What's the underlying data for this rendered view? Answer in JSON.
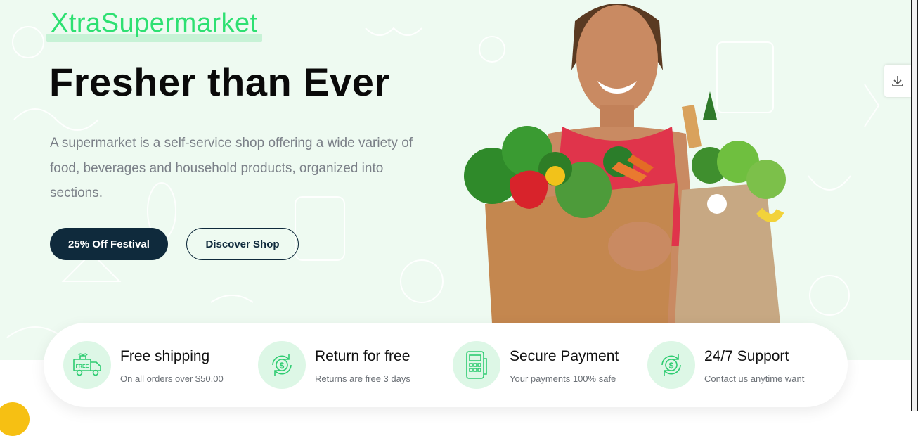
{
  "brand": {
    "name": "XtraSupermarket"
  },
  "hero": {
    "headline": "Fresher than Ever",
    "description": "A supermarket is a self-service shop offering a wide variety of food, beverages and household products, organized into sections.",
    "primary_button": "25% Off Festival",
    "secondary_button": "Discover Shop"
  },
  "features": [
    {
      "title": "Free shipping",
      "subtitle": "On all orders over $50.00",
      "icon": "free-delivery-truck-icon"
    },
    {
      "title": "Return for free",
      "subtitle": "Returns are free 3 days",
      "icon": "dollar-refresh-icon"
    },
    {
      "title": "Secure Payment",
      "subtitle": "Your payments 100% safe",
      "icon": "card-terminal-icon"
    },
    {
      "title": "24/7 Support",
      "subtitle": "Contact us anytime want",
      "icon": "dollar-refresh-icon"
    }
  ],
  "colors": {
    "brand_green": "#2ee072",
    "hero_background": "#eefaf1",
    "primary_dark": "#0f2a3c",
    "icon_circle": "#ddf7e6",
    "accent_yellow": "#f6c013"
  }
}
